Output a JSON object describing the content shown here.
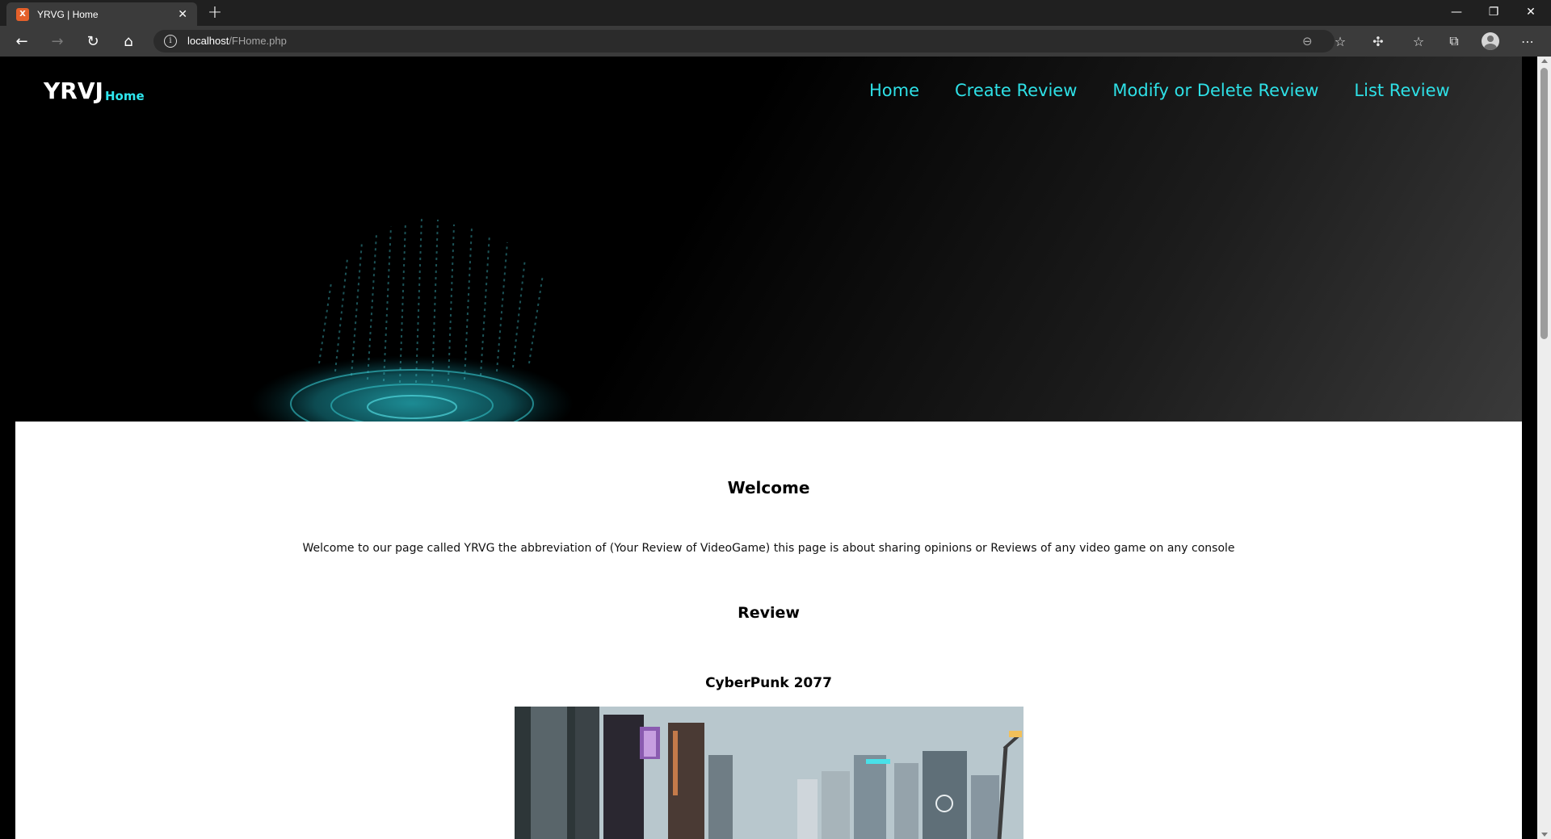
{
  "browser": {
    "tab_title": "YRVG | Home",
    "favicon_label": "X",
    "url_host": "localhost",
    "url_path": "/FHome.php"
  },
  "header": {
    "logo": "YRVJ",
    "logo_sub": "Home",
    "nav": [
      "Home",
      "Create Review",
      "Modify or Delete Review",
      "List Review"
    ],
    "accent_color": "#2ee0e6"
  },
  "main": {
    "welcome_title": "Welcome",
    "welcome_text": "Welcome to our page called YRVG the abbreviation of (Your Review of VideoGame) this page is about sharing opinions or Reviews of any video game on any console",
    "review_title": "Review",
    "game_title": "CyberPunk 2077"
  }
}
